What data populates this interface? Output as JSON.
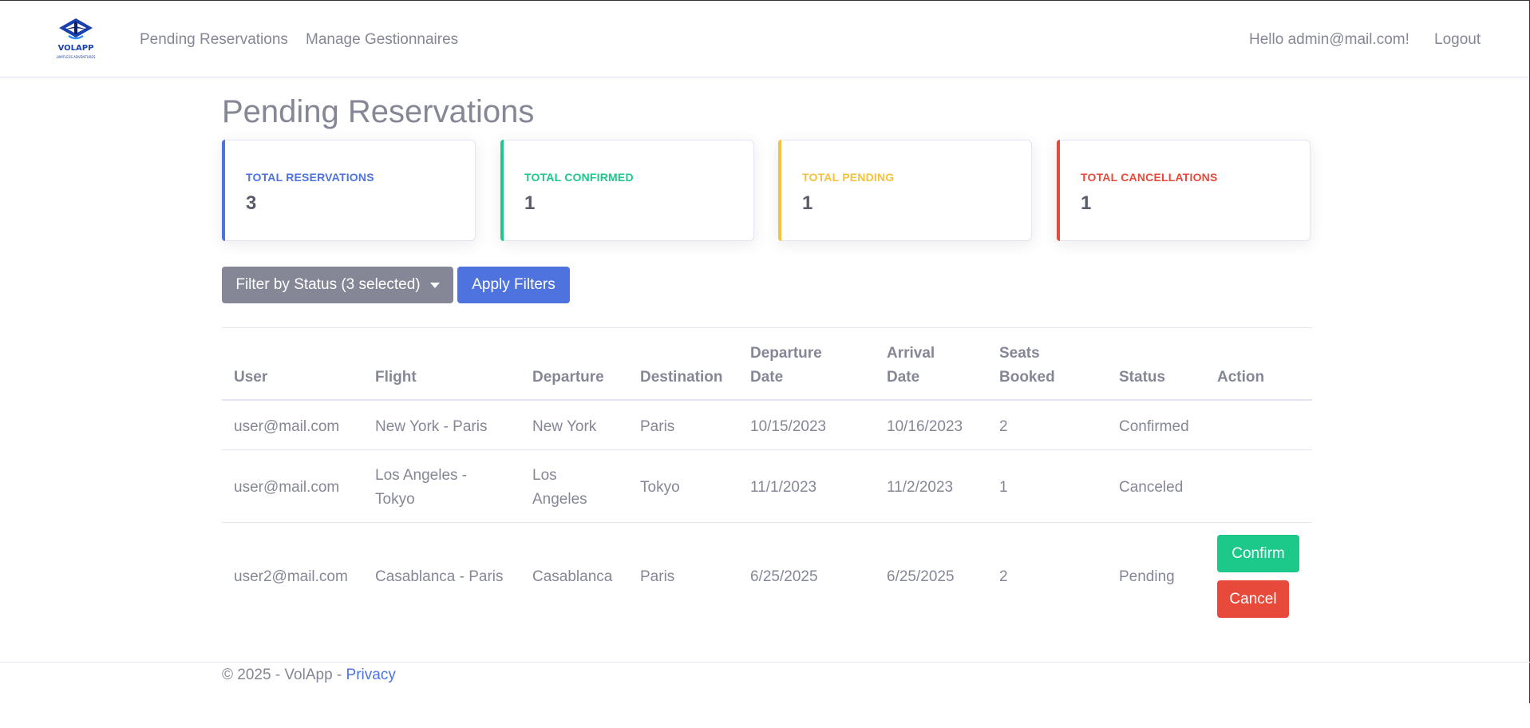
{
  "brand": {
    "logo_text": "VOLAPP",
    "logo_tagline": "LIMITLESS ADVENTURES"
  },
  "nav": {
    "links": [
      {
        "label": "Pending Reservations"
      },
      {
        "label": "Manage Gestionnaires"
      }
    ],
    "greeting": "Hello admin@mail.com!",
    "logout": "Logout"
  },
  "page": {
    "title": "Pending Reservations"
  },
  "stats": [
    {
      "label": "TOTAL RESERVATIONS",
      "value": "3",
      "color": "#4e73df"
    },
    {
      "label": "TOTAL CONFIRMED",
      "value": "1",
      "color": "#1cc88a"
    },
    {
      "label": "TOTAL PENDING",
      "value": "1",
      "color": "#f6c23e"
    },
    {
      "label": "TOTAL CANCELLATIONS",
      "value": "1",
      "color": "#e74a3b"
    }
  ],
  "filters": {
    "status_dropdown": "Filter by Status (3 selected)",
    "apply": "Apply Filters"
  },
  "table": {
    "headers": {
      "user": "User",
      "flight": "Flight",
      "departure": "Departure",
      "destination": "Destination",
      "departure_date_1": "Departure",
      "departure_date_2": "Date",
      "arrival_date_1": "Arrival",
      "arrival_date_2": "Date",
      "seats_1": "Seats",
      "seats_2": "Booked",
      "status": "Status",
      "action": "Action"
    },
    "rows": [
      {
        "user": "user@mail.com",
        "flight": "New York - Paris",
        "departure": "New York",
        "destination": "Paris",
        "departure_date": "10/15/2023",
        "arrival_date": "10/16/2023",
        "seats": "2",
        "status": "Confirmed"
      },
      {
        "user": "user@mail.com",
        "flight_1": "Los Angeles -",
        "flight_2": "Tokyo",
        "departure_1": "Los",
        "departure_2": "Angeles",
        "destination": "Tokyo",
        "departure_date": "11/1/2023",
        "arrival_date": "11/2/2023",
        "seats": "1",
        "status": "Canceled"
      },
      {
        "user": "user2@mail.com",
        "flight": "Casablanca - Paris",
        "departure": "Casablanca",
        "destination": "Paris",
        "departure_date": "6/25/2025",
        "arrival_date": "6/25/2025",
        "seats": "2",
        "status": "Pending",
        "confirm_label": "Confirm",
        "cancel_label": "Cancel"
      }
    ]
  },
  "footer": {
    "text": "© 2025 - VolApp - ",
    "privacy": "Privacy"
  },
  "colors": {
    "primary": "#4e73df",
    "success": "#1cc88a",
    "warning": "#f6c23e",
    "danger": "#e74a3b",
    "secondary": "#858796"
  }
}
